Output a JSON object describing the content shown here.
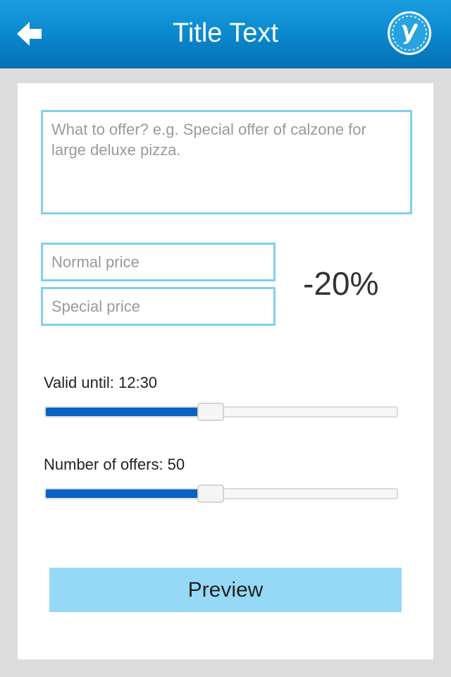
{
  "header": {
    "title": "Title Text",
    "back_icon": "back-arrow-icon",
    "logo_icon": "y-logo-icon",
    "colors": {
      "bar_top": "#1a9ee0",
      "bar_bottom": "#0670b4",
      "title_text": "#ffffff"
    }
  },
  "form": {
    "offer": {
      "value": "",
      "placeholder": "What to offer? e.g. Special offer of calzone for large deluxe pizza."
    },
    "normal_price": {
      "value": "",
      "placeholder": "Normal price"
    },
    "special_price": {
      "value": "",
      "placeholder": "Special price"
    },
    "discount": "-20%",
    "valid_until": {
      "label": "Valid until: 12:30",
      "level": 0.47
    },
    "number_of_offers": {
      "label": "Number of offers: 50",
      "level": 0.47
    },
    "preview_label": "Preview",
    "colors": {
      "field_border": "#80d0f0",
      "slider_fill": "#0a62c4",
      "button_bg": "#96d9f6"
    }
  }
}
